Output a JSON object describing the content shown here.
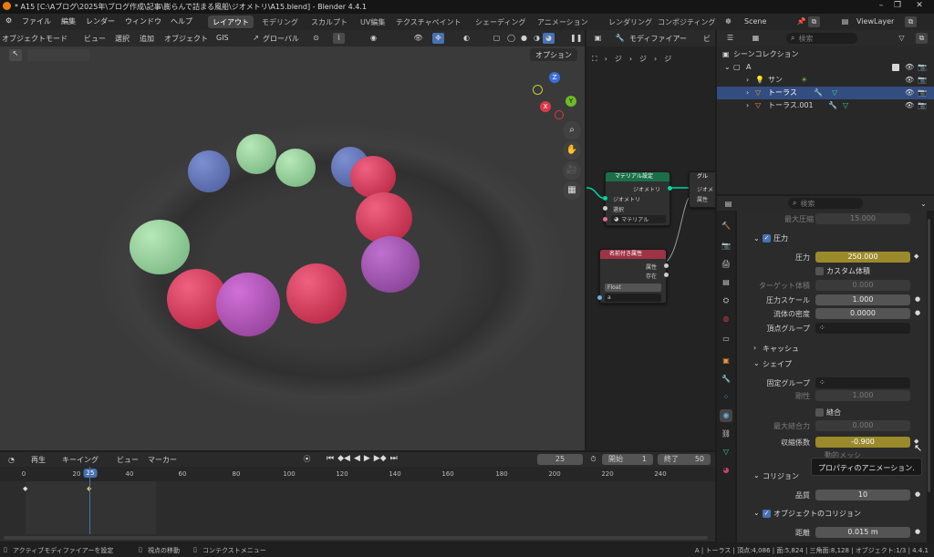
{
  "window": {
    "title": "* A15 [C:\\Aブログ\\2025年\\ブログ作成\\記事\\膨らんで詰まる風船\\ジオメトリ\\A15.blend] - Blender 4.4.1"
  },
  "menu": {
    "items": [
      "ファイル",
      "編集",
      "レンダー",
      "ウィンドウ",
      "ヘルプ"
    ],
    "workspaces": [
      "レイアウト",
      "モデリング",
      "スカルプト",
      "UV編集",
      "テクスチャペイント",
      "シェーディング",
      "アニメーション",
      "レンダリング",
      "コンポジティング"
    ],
    "active_workspace": "レイアウト"
  },
  "viewport_header": {
    "mode": "オブジェクトモード",
    "menus": [
      "ビュー",
      "選択",
      "追加",
      "オブジェクト",
      "GIS"
    ],
    "orientation": "グローバル",
    "options": "オプション"
  },
  "node_editor": {
    "header_label": "モディファイアー",
    "header_view": "ビ",
    "breadcrumb": [
      "ジ",
      "ジ",
      "ジ"
    ],
    "node_material": {
      "title": "マテリアル設定",
      "output": "ジオメトリ",
      "inputs": [
        "ジオメトリ",
        "選択"
      ],
      "material": "マテリアル"
    },
    "node_named_attr": {
      "title": "名前付き属性",
      "outputs": [
        "属性",
        "存在"
      ],
      "type": "Float",
      "name_value": "a"
    },
    "node_group": {
      "title": "グル",
      "rows": [
        "ジオメ",
        "属性"
      ]
    }
  },
  "outliner": {
    "scene": "Scene",
    "view_layer": "ViewLayer",
    "search_placeholder": "検索",
    "collection_root": "シーンコレクション",
    "rows": [
      {
        "name": "A",
        "level": 1
      },
      {
        "name": "サン",
        "level": 2
      },
      {
        "name": "トーラス",
        "level": 2,
        "selected": true
      },
      {
        "name": "トーラス.001",
        "level": 2
      }
    ]
  },
  "properties": {
    "search_placeholder": "検索",
    "max_pressure": {
      "label": "最大圧縮",
      "value": "15.000"
    },
    "pressure_panel": "圧力",
    "pressure": {
      "label": "圧力",
      "value": "250.000"
    },
    "custom_volume": "カスタム体積",
    "target_volume": {
      "label": "ターゲット体積",
      "value": "0.000"
    },
    "pressure_scale": {
      "label": "圧力スケール",
      "value": "1.000"
    },
    "fluid_density": {
      "label": "流体の密度",
      "value": "0.0000"
    },
    "vertex_group": {
      "label": "頂点グループ"
    },
    "cache_panel": "キャッシュ",
    "shape_panel": "シェイプ",
    "pin_group": {
      "label": "固定グループ"
    },
    "stiffness": {
      "label": "剛性",
      "value": "1.000"
    },
    "sewing": "縫合",
    "max_sewing": {
      "label": "最大縫合力",
      "value": "0.000"
    },
    "shrink": {
      "label": "収縮係数",
      "value": "-0.900"
    },
    "dynamic_mesh_partial": "動的メッシ",
    "tooltip": "プロパティのアニメーション.",
    "collision_panel": "コリジョン",
    "quality": {
      "label": "品質",
      "value": "10"
    },
    "object_collision": "オブジェクトのコリジョン",
    "distance": {
      "label": "距離",
      "value": "0.015 m"
    }
  },
  "timeline": {
    "play": "再生",
    "keying": "キーイング",
    "view": "ビュー",
    "marker": "マーカー",
    "current_frame": "25",
    "start_label": "開始",
    "start": "1",
    "end_label": "終了",
    "end": "50",
    "ticks": [
      "0",
      "20",
      "25",
      "40",
      "60",
      "80",
      "100",
      "120",
      "140",
      "160",
      "180",
      "200",
      "220",
      "240"
    ]
  },
  "statusbar": {
    "left": [
      "アクティブモディファイアーを設定",
      "視点の移動",
      "コンテクストメニュー"
    ],
    "right": "A | トーラス | 頂点:4,086 | 面:5,824 | 三角面:8,128 | オブジェクト:1/3 | 4.4.1"
  },
  "colors": {
    "accent_blue": "#4772b3",
    "selected_row": "#334d80",
    "animated_field": "#9a8a2b",
    "node_geometry_socket": "#00d6a3",
    "material_header": "#1c6e4a",
    "attribute_header": "#9e3345"
  }
}
